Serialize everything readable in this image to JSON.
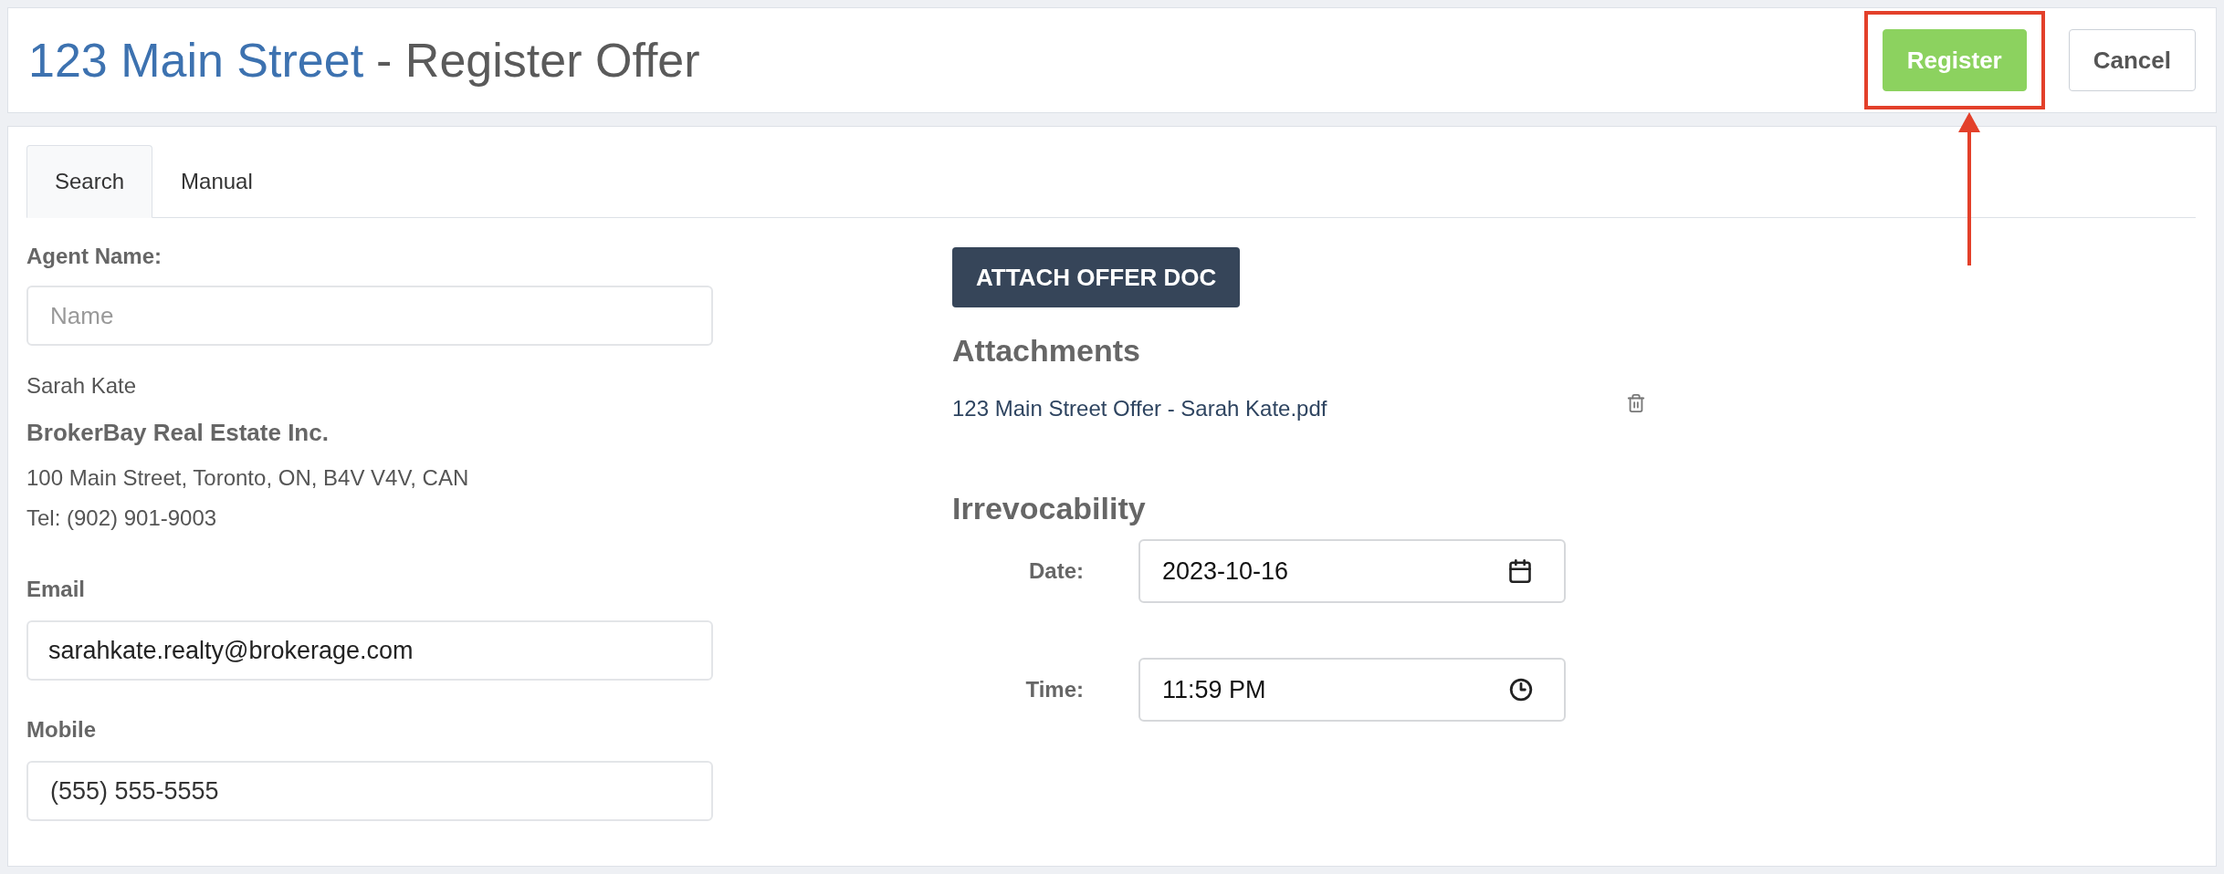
{
  "header": {
    "title_link": "123 Main Street",
    "title_rest": "- Register Offer"
  },
  "buttons": [
    {
      "label": "Register",
      "kind": "primary",
      "highlighted": true
    },
    {
      "label": "Cancel",
      "kind": "default",
      "highlighted": false
    }
  ],
  "tabs": [
    {
      "label": "Search",
      "selected": true
    },
    {
      "label": "Manual",
      "selected": false
    }
  ],
  "agent": {
    "label": "Agent Name:",
    "placeholder": "Name"
  },
  "agent_card": {
    "name": "Sarah Kate",
    "brokerage": "BrokerBay Real Estate Inc.",
    "address": "100 Main Street, Toronto, ON, B4V V4V, CAN",
    "tel": "Tel: (902) 901-9003"
  },
  "email": {
    "label": "Email",
    "value": "sarahkate.realty@brokerage.com"
  },
  "mobile": {
    "label": "Mobile",
    "value": "(555) 555-5555"
  },
  "attach_button": "ATTACH OFFER DOC",
  "attachments": {
    "heading": "Attachments",
    "files": [
      "123 Main Street Offer - Sarah Kate.pdf"
    ]
  },
  "irrevocability": {
    "heading": "Irrevocability",
    "fields": [
      {
        "kind": "date",
        "label": "Date:",
        "value": "2023-10-16"
      },
      {
        "kind": "time",
        "label": "Time:",
        "value": "11:59 PM"
      }
    ]
  }
}
